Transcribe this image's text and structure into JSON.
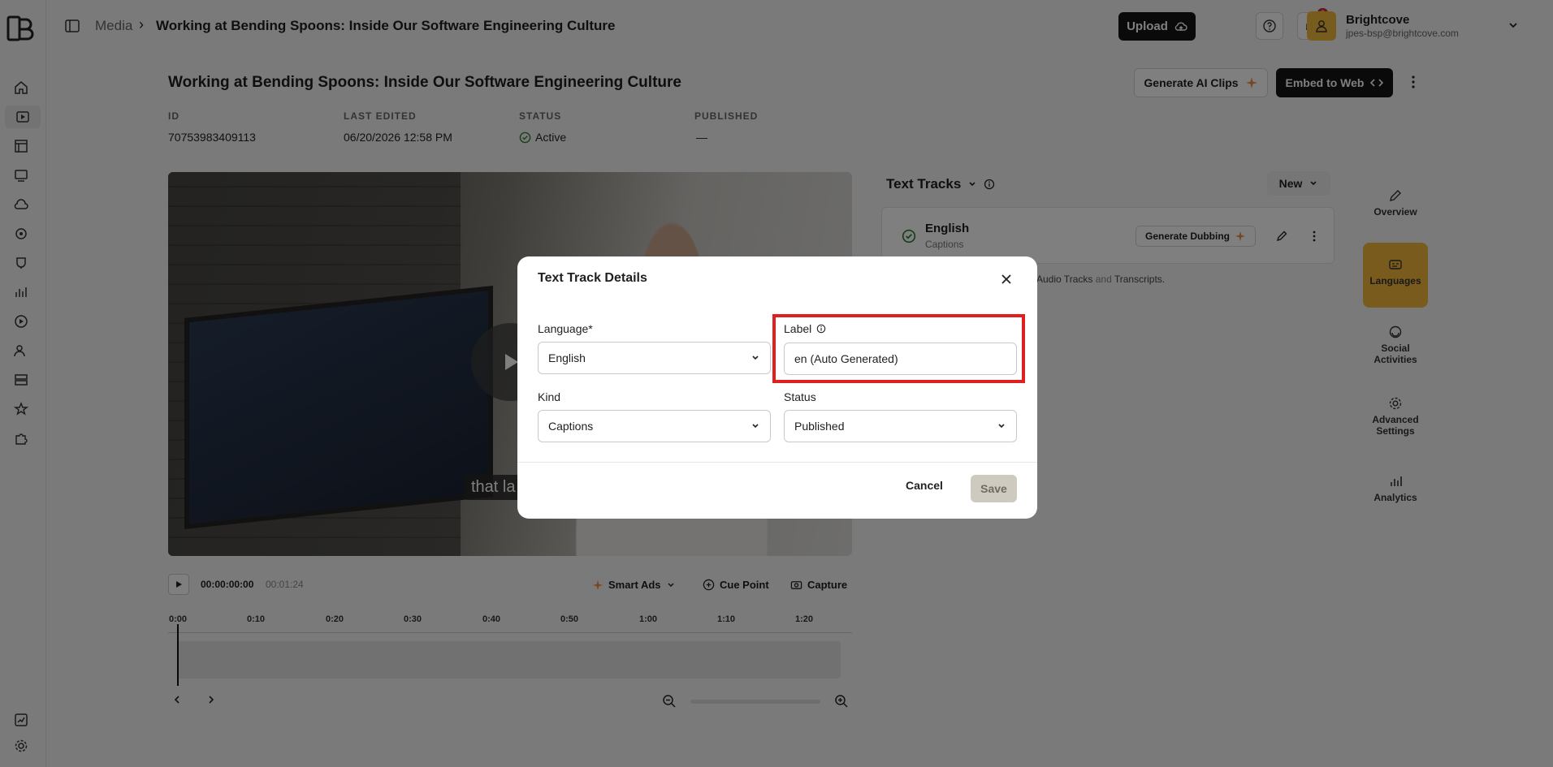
{
  "topbar": {
    "breadcrumb_root": "Media",
    "breadcrumb_sep": "›",
    "breadcrumb_title": "Working at Bending Spoons: Inside Our Software Engineering Culture",
    "upload_label": "Upload",
    "notification_count": "3",
    "user_name": "Brightcove",
    "user_email": "jpes-bsp@brightcove.com"
  },
  "page": {
    "title": "Working at Bending Spoons: Inside Our Software Engineering Culture",
    "generate_ai_clips_label": "Generate AI Clips",
    "embed_label": "Embed to Web",
    "meta": {
      "id_label": "ID",
      "id_value": "70753983409113",
      "last_edited_label": "LAST EDITED",
      "last_edited_value": "06/20/2026 12:58 PM",
      "status_label": "STATUS",
      "status_value": "Active",
      "published_label": "PUBLISHED",
      "published_value": "—"
    }
  },
  "player": {
    "caption_text": "that la",
    "current_time": "00:00:00:00",
    "duration": "00:01:24",
    "smart_ads_label": "Smart Ads",
    "cue_point_label": "Cue Point",
    "capture_label": "Capture",
    "timeline_ticks": [
      "0:00",
      "0:10",
      "0:20",
      "0:30",
      "0:40",
      "0:50",
      "1:00",
      "1:10",
      "1:20"
    ]
  },
  "text_tracks": {
    "title": "Text Tracks",
    "new_label": "New",
    "track_name": "English",
    "track_kind": "Captions",
    "generate_dubbing_label": "Generate Dubbing",
    "help_audio": "Audio Tracks",
    "help_and": "and",
    "help_transcripts": "Transcripts."
  },
  "side_nav": {
    "overview": "Overview",
    "languages": "Languages",
    "social": "Social Activities",
    "advanced": "Advanced Settings",
    "analytics": "Analytics"
  },
  "modal": {
    "title": "Text Track Details",
    "language_label": "Language*",
    "language_value": "English",
    "label_label": "Label",
    "label_value": "en (Auto Generated)",
    "kind_label": "Kind",
    "kind_value": "Captions",
    "status_label": "Status",
    "status_value": "Published",
    "cancel_label": "Cancel",
    "save_label": "Save"
  },
  "colors": {
    "accent": "#f2b93b",
    "dark_button": "#151515",
    "highlight": "#e0201e",
    "status_green": "#2e7d32"
  }
}
